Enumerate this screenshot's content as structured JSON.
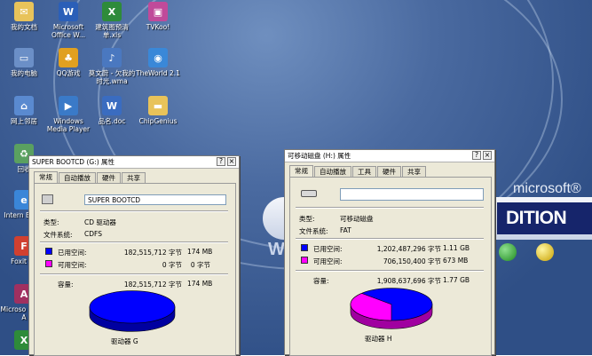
{
  "desktop": {
    "logo_text": "microsoft®",
    "edition_text": "DITION",
    "icons": [
      {
        "label": "我的文档",
        "icon": "my-documents-icon",
        "color": "#e8c35a",
        "glyph": "✉"
      },
      {
        "label": "Microsoft Office W...",
        "icon": "word-icon",
        "color": "#2b5fb8",
        "glyph": "W"
      },
      {
        "label": "建筑图预清单.xls",
        "icon": "excel-file-icon",
        "color": "#2e8b3a",
        "glyph": "X"
      },
      {
        "label": "TVKoo!",
        "icon": "tvkoo-icon",
        "color": "#c04a9a",
        "glyph": "▣"
      },
      {
        "label": "我的电脑",
        "icon": "my-computer-icon",
        "color": "#6b8fc7",
        "glyph": "▭"
      },
      {
        "label": "QQ游戏",
        "icon": "qq-game-icon",
        "color": "#e0a020",
        "glyph": "♣"
      },
      {
        "label": "莫文蔚 - 欠我的时光.wma",
        "icon": "audio-file-icon",
        "color": "#4a78c0",
        "glyph": "♪"
      },
      {
        "label": "TheWorld 2.1",
        "icon": "theworld-browser-icon",
        "color": "#3a88d8",
        "glyph": "◉"
      },
      {
        "label": "网上邻居",
        "icon": "network-places-icon",
        "color": "#5a8ad0",
        "glyph": "⌂"
      },
      {
        "label": "Windows Media Player",
        "icon": "media-player-icon",
        "color": "#3a7ac8",
        "glyph": "▶"
      },
      {
        "label": "品名.doc",
        "icon": "word-doc-icon",
        "color": "#3a6cc0",
        "glyph": "W"
      },
      {
        "label": "ChipGenius",
        "icon": "folder-icon",
        "color": "#e8c35a",
        "glyph": "▬"
      },
      {
        "label": "回收",
        "icon": "recycle-bin-icon",
        "color": "#5aa060",
        "glyph": "♻"
      },
      {
        "label": "Intern Explo",
        "icon": "internet-explorer-icon",
        "color": "#3a86d8",
        "glyph": "e"
      },
      {
        "label": "Foxit Re",
        "icon": "foxit-reader-icon",
        "color": "#d04030",
        "glyph": "F"
      },
      {
        "label": "Microso Office A",
        "icon": "office-access-icon",
        "color": "#a03060",
        "glyph": "A"
      },
      {
        "label": "",
        "icon": "excel-icon",
        "color": "#2e8b3a",
        "glyph": "X"
      }
    ]
  },
  "win1": {
    "title": "SUPER BOOTCD (G:) 属性",
    "tabs": [
      "常规",
      "自动播放",
      "硬件",
      "共享"
    ],
    "active_tab": 0,
    "name_value": "SUPER BOOTCD",
    "type_label": "类型:",
    "type_value": "CD 驱动器",
    "fs_label": "文件系统:",
    "fs_value": "CDFS",
    "used_label": "已用空间:",
    "used_bytes": "182,515,712 字节",
    "used_size": "174 MB",
    "free_label": "可用空间:",
    "free_bytes": "0 字节",
    "free_size": "0 字节",
    "cap_label": "容量:",
    "cap_bytes": "182,515,712 字节",
    "cap_size": "174 MB",
    "drive_label": "驱动器 G",
    "used_color": "#0000ff",
    "free_color": "#ff00ff",
    "used_fraction": 1.0
  },
  "win2": {
    "title": "可移动磁盘 (H:) 属性",
    "tabs": [
      "常规",
      "自动播放",
      "工具",
      "硬件",
      "共享"
    ],
    "active_tab": 0,
    "name_value": "",
    "type_label": "类型:",
    "type_value": "可移动磁盘",
    "fs_label": "文件系统:",
    "fs_value": "FAT",
    "used_label": "已用空间:",
    "used_bytes": "1,202,487,296 字节",
    "used_size": "1.11 GB",
    "free_label": "可用空间:",
    "free_bytes": "706,150,400 字节",
    "free_size": "673 MB",
    "cap_label": "容量:",
    "cap_bytes": "1,908,637,696 字节",
    "cap_size": "1.77 GB",
    "drive_label": "驱动器 H",
    "used_color": "#0000ff",
    "free_color": "#ff00ff",
    "used_fraction": 0.63
  },
  "buttons": {
    "help": "?",
    "close": "×"
  }
}
